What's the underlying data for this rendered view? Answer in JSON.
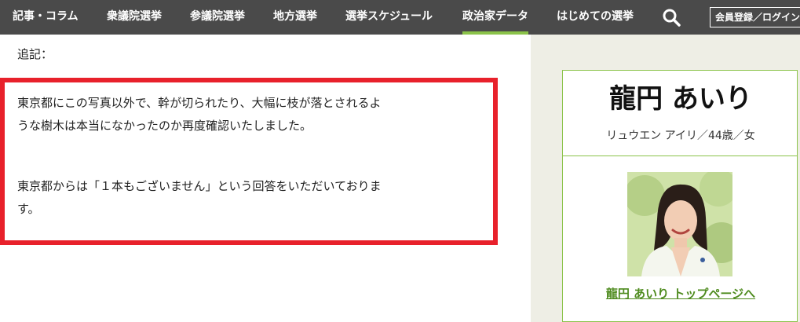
{
  "nav": {
    "items": [
      {
        "label": "記事・コラム"
      },
      {
        "label": "衆議院選挙"
      },
      {
        "label": "参議院選挙"
      },
      {
        "label": "地方選挙"
      },
      {
        "label": "選挙スケジュール"
      },
      {
        "label": "政治家データ",
        "active": true
      },
      {
        "label": "はじめての選挙"
      }
    ],
    "search_icon": "search-icon",
    "member_button": "会員登録／ログイン"
  },
  "article": {
    "postscript_label": "追記：",
    "highlight": {
      "paragraph1_line1": "東京都にこの写真以外で、幹が切られたり、大幅に枝が落とされるよ",
      "paragraph1_line2": "うな樹木は本当になかったのか再度確認いたしました。",
      "paragraph2_line1": "東京都からは「１本もございません」という回答をいただいておりま",
      "paragraph2_line2": "す。",
      "border_color": "#e8212b"
    }
  },
  "profile": {
    "name": "龍円 あいり",
    "info": "リュウエン アイリ／44歳／女",
    "photo_icon": "politician-photo",
    "top_link": "龍円 あいり トップページへ",
    "accent_color": "#8bc34a"
  }
}
